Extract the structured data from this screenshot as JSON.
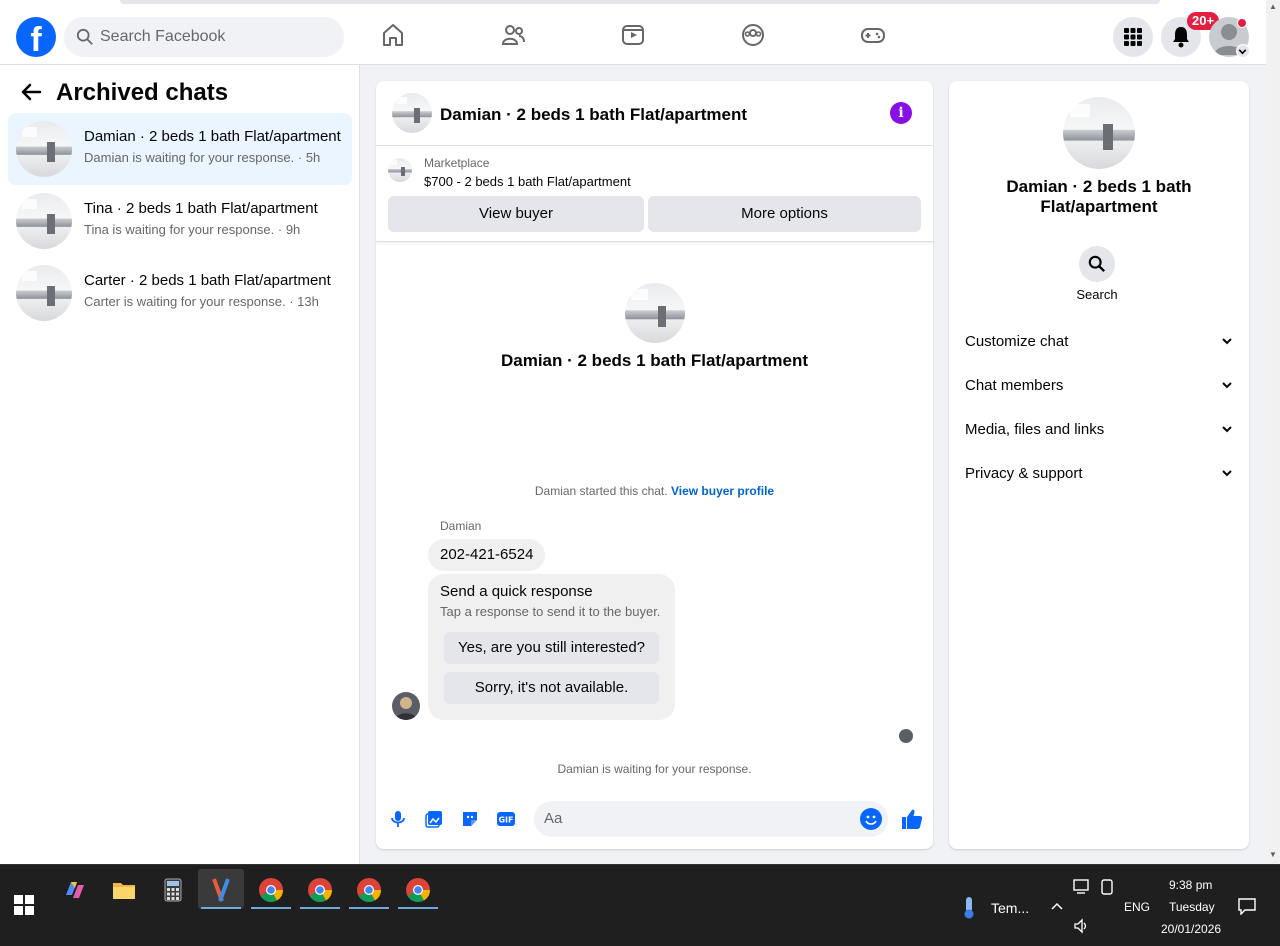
{
  "topbar": {
    "search_placeholder": "Search Facebook",
    "notifications_badge": "20+"
  },
  "archived": {
    "title": "Archived chats",
    "chats": [
      {
        "name": "Damian · 2 beds 1 bath Flat/apartment",
        "status": "Damian is waiting for your response. · 5h"
      },
      {
        "name": "Tina · 2 beds 1 bath Flat/apartment",
        "status": "Tina is waiting for your response. · 9h"
      },
      {
        "name": "Carter · 2 beds 1 bath Flat/apartment",
        "status": "Carter is waiting for your response. · 13h"
      }
    ]
  },
  "chat": {
    "title": "Damian · 2 beds 1 bath Flat/apartment",
    "marketplace_label": "Marketplace",
    "listing": "$700 - 2 beds 1 bath Flat/apartment",
    "view_buyer": "View buyer",
    "more_options": "More options",
    "started_text": "Damian started this chat.",
    "view_buyer_profile": "View buyer profile",
    "sender": "Damian",
    "message": "202-421-6524",
    "quick_title": "Send a quick response",
    "quick_sub": "Tap a response to send it to the buyer.",
    "quick_1": "Yes, are you still interested?",
    "quick_2": "Sorry, it's not available.",
    "waiting": "Damian is waiting for your response.",
    "composer_placeholder": "Aa"
  },
  "details": {
    "title": "Damian · 2 beds 1 bath Flat/apartment",
    "search_label": "Search",
    "sections": [
      "Customize chat",
      "Chat members",
      "Media, files and links",
      "Privacy & support"
    ]
  },
  "taskbar": {
    "weather": "Tem...",
    "lang": "ENG",
    "time": "9:38 pm",
    "day": "Tuesday",
    "date": "20/01/2026"
  },
  "colors": {
    "brand": "#0866ff",
    "info": "#8a0ee6",
    "badge": "#e41e3f"
  }
}
